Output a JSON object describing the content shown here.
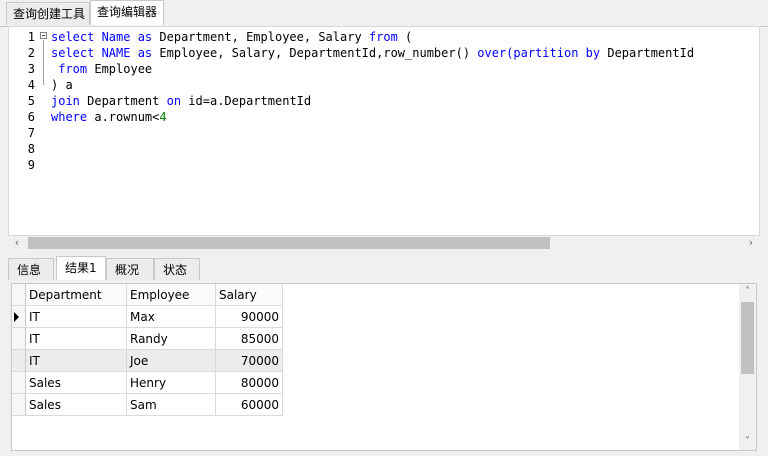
{
  "top_tabs": [
    {
      "label": "查询创建工具"
    },
    {
      "label": "查询编辑器"
    }
  ],
  "editor": {
    "line_numbers": [
      "1",
      "2",
      "3",
      "4",
      "5",
      "6",
      "7",
      "8",
      "9"
    ],
    "lines": [
      [
        {
          "t": "select ",
          "k": "kw"
        },
        {
          "t": "Name ",
          "k": "kw"
        },
        {
          "t": "as ",
          "k": "kw"
        },
        {
          "t": "Department, Employee, Salary "
        },
        {
          "t": "from ",
          "k": "kw"
        },
        {
          "t": "("
        }
      ],
      [
        {
          "t": "select ",
          "k": "kw"
        },
        {
          "t": "NAME ",
          "k": "kw"
        },
        {
          "t": "as ",
          "k": "kw"
        },
        {
          "t": "Employee, Salary, DepartmentId,row_number() "
        },
        {
          "t": "over(",
          "k": "kw"
        },
        {
          "t": "partition ",
          "k": "kw"
        },
        {
          "t": "by ",
          "k": "kw"
        },
        {
          "t": "DepartmentId"
        }
      ],
      [
        {
          "t": " from ",
          "k": "kw"
        },
        {
          "t": "Employee"
        }
      ],
      [
        {
          "t": ") a"
        }
      ],
      [
        {
          "t": "join ",
          "k": "kw"
        },
        {
          "t": "Department "
        },
        {
          "t": "on ",
          "k": "kw"
        },
        {
          "t": "id=a.DepartmentId"
        }
      ],
      [
        {
          "t": "where ",
          "k": "kw"
        },
        {
          "t": "a.rownum<"
        },
        {
          "t": "4",
          "k": "num"
        }
      ],
      [],
      [],
      []
    ]
  },
  "scroll": {
    "left_arrow": "‹",
    "right_arrow": "›",
    "up_arrow": "˄",
    "down_arrow": "˅"
  },
  "result_tabs": [
    {
      "label": "信息"
    },
    {
      "label": "结果1"
    },
    {
      "label": "概况"
    },
    {
      "label": "状态"
    }
  ],
  "grid": {
    "columns": [
      "Department",
      "Employee",
      "Salary"
    ],
    "rows": [
      {
        "department": "IT",
        "employee": "Max",
        "salary": "90000"
      },
      {
        "department": "IT",
        "employee": "Randy",
        "salary": "85000"
      },
      {
        "department": "IT",
        "employee": "Joe",
        "salary": "70000"
      },
      {
        "department": "Sales",
        "employee": "Henry",
        "salary": "80000"
      },
      {
        "department": "Sales",
        "employee": "Sam",
        "salary": "60000"
      }
    ],
    "current_row": 0,
    "highlighted_row": 2
  },
  "colors": {
    "keyword": "#0000ff",
    "number": "#008000"
  }
}
